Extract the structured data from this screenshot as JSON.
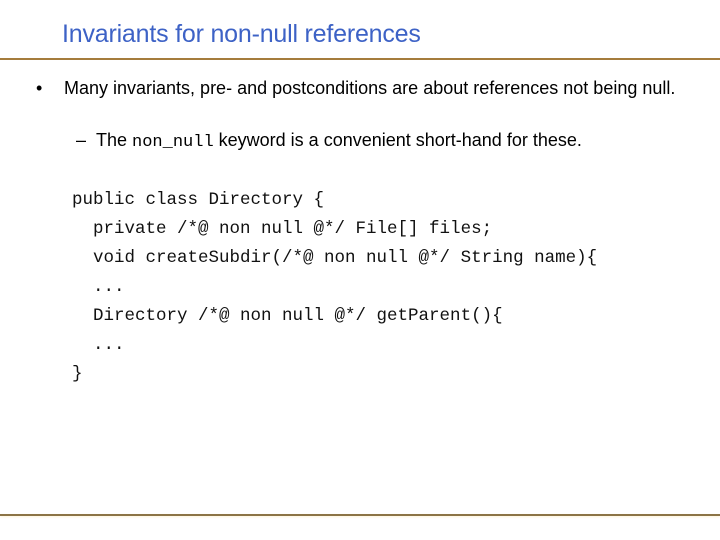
{
  "slide": {
    "title": "Invariants for non-null references",
    "colors": {
      "title": "#3d62c6",
      "rule": "#a57c3c",
      "text": "#000000"
    },
    "bullets": [
      {
        "marker": "•",
        "text": "Many invariants, pre- and postconditions are about references not being null.",
        "sub_bullets": [
          {
            "marker": "–",
            "prefix": "The ",
            "code": "non_null",
            "suffix": " keyword is a convenient short-hand for these."
          }
        ]
      }
    ],
    "code_lines": [
      "public class Directory {",
      "  private /*@ non null @*/ File[] files;",
      "  void createSubdir(/*@ non null @*/ String name){",
      "  ...",
      "  Directory /*@ non null @*/ getParent(){",
      "  ...",
      "}"
    ]
  }
}
